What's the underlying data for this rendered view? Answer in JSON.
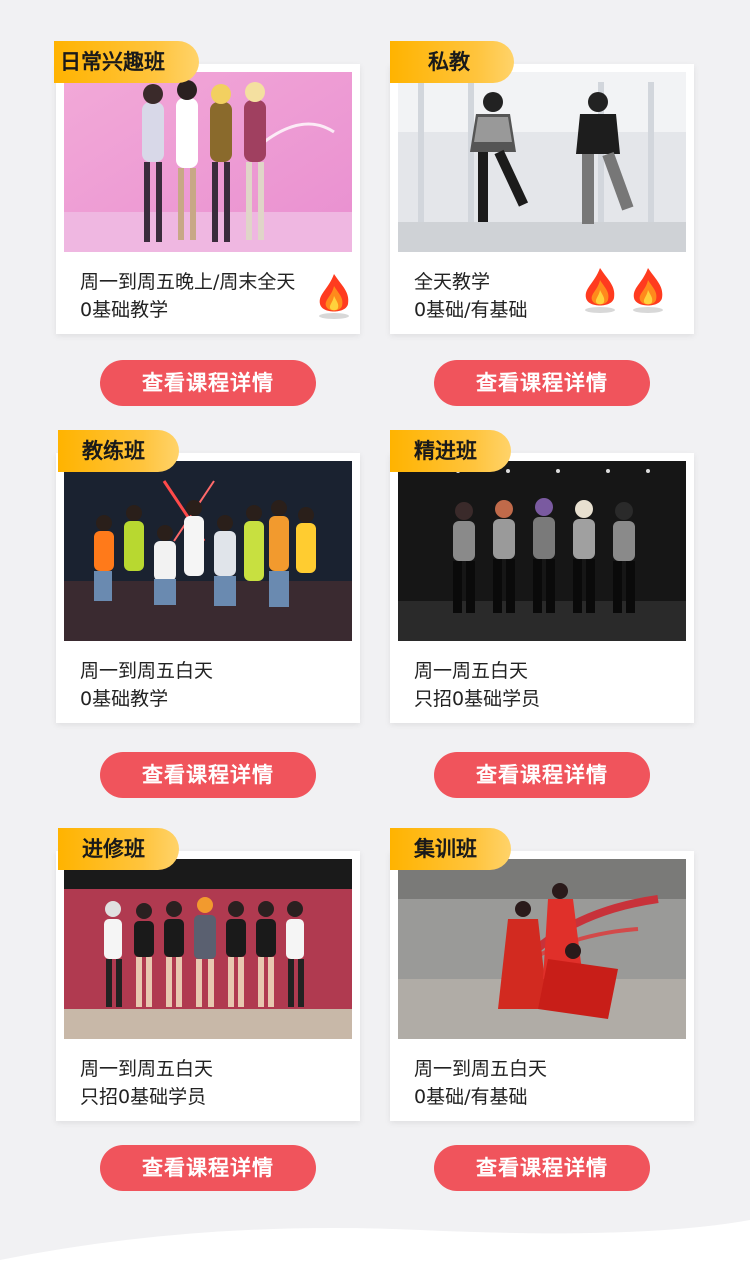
{
  "courses": [
    {
      "name": "日常兴趣班",
      "line1": "周一到周五晚上/周末全天",
      "line2": "0基础教学",
      "button": "查看课程详情",
      "hot": 1
    },
    {
      "name": "私教",
      "line1": "全天教学",
      "line2": "0基础/有基础",
      "button": "查看课程详情",
      "hot": 2
    },
    {
      "name": "教练班",
      "line1": "周一到周五白天",
      "line2": "0基础教学",
      "button": "查看课程详情",
      "hot": 0
    },
    {
      "name": "精进班",
      "line1": "周一周五白天",
      "line2": "只招0基础学员",
      "button": "查看课程详情",
      "hot": 0
    },
    {
      "name": "进修班",
      "line1": "周一到周五白天",
      "line2": "只招0基础学员",
      "button": "查看课程详情",
      "hot": 0
    },
    {
      "name": "集训班",
      "line1": "周一到周五白天",
      "line2": "0基础/有基础",
      "button": "查看课程详情",
      "hot": 0
    }
  ],
  "colors": {
    "badge": "#ffb300",
    "button": "#f0545c",
    "background": "#f1f1f3"
  },
  "icons": {
    "hot": "flame-icon"
  }
}
